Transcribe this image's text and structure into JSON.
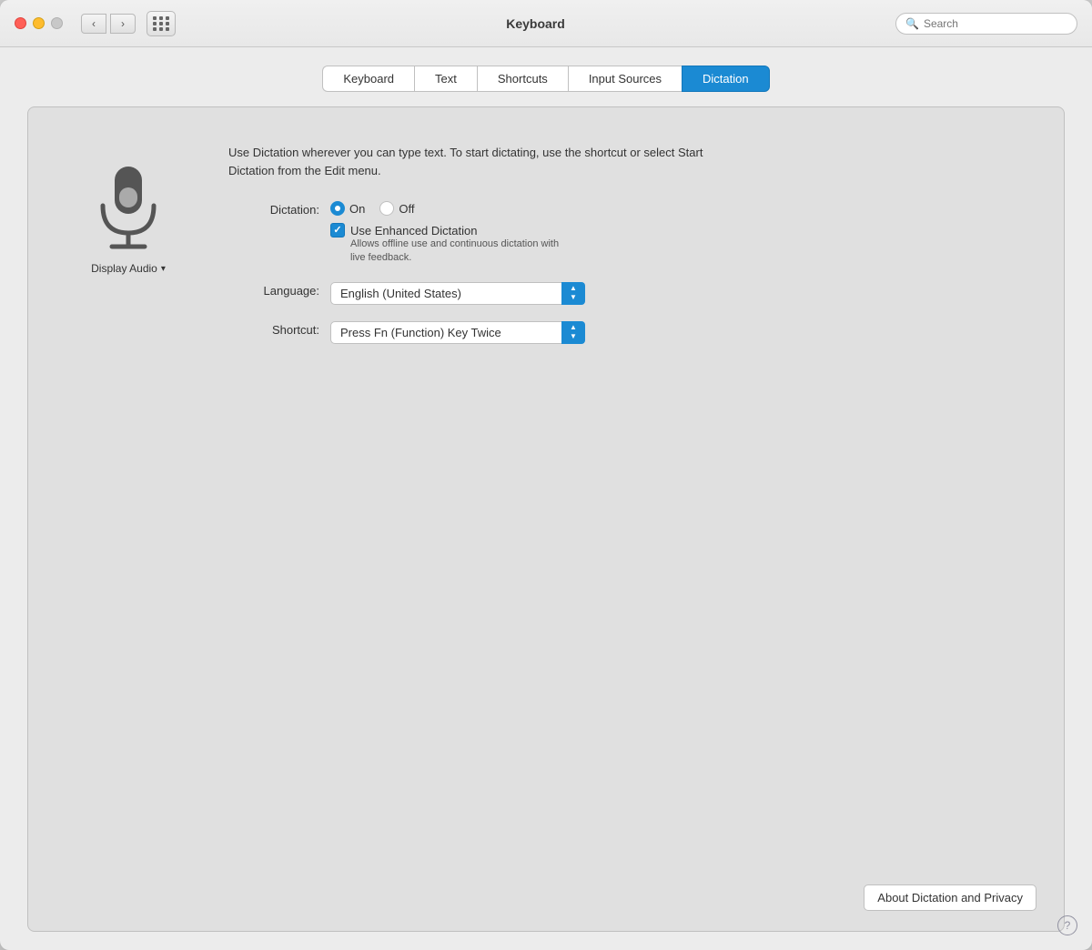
{
  "window": {
    "title": "Keyboard",
    "search_placeholder": "Search"
  },
  "titlebar": {
    "back_label": "‹",
    "forward_label": "›"
  },
  "tabs": [
    {
      "id": "keyboard",
      "label": "Keyboard",
      "active": false
    },
    {
      "id": "text",
      "label": "Text",
      "active": false
    },
    {
      "id": "shortcuts",
      "label": "Shortcuts",
      "active": false
    },
    {
      "id": "input-sources",
      "label": "Input Sources",
      "active": false
    },
    {
      "id": "dictation",
      "label": "Dictation",
      "active": true
    }
  ],
  "dictation": {
    "description": "Use Dictation wherever you can type text. To start dictating, use the shortcut or select Start Dictation from the Edit menu.",
    "dictation_label": "Dictation:",
    "on_label": "On",
    "off_label": "Off",
    "enhanced_label": "Use Enhanced Dictation",
    "enhanced_sub": "Allows offline use and continuous dictation with\nlive feedback.",
    "language_label": "Language:",
    "language_value": "English (United States)",
    "shortcut_label": "Shortcut:",
    "shortcut_value": "Press Fn (Function) Key Twice",
    "display_audio_label": "Display Audio",
    "about_btn_label": "About Dictation and Privacy",
    "help_label": "?"
  }
}
